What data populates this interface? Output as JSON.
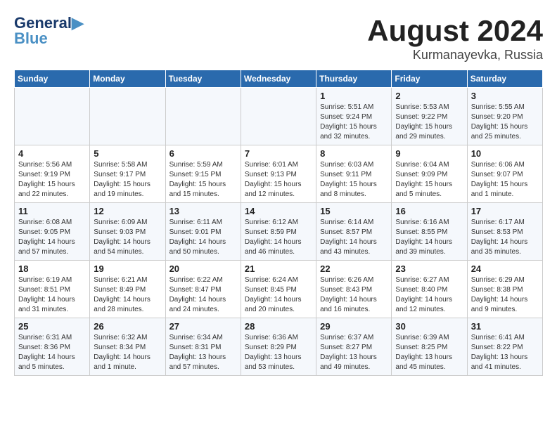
{
  "header": {
    "logo_general": "General",
    "logo_blue": "Blue",
    "month_year": "August 2024",
    "location": "Kurmanayevka, Russia"
  },
  "weekdays": [
    "Sunday",
    "Monday",
    "Tuesday",
    "Wednesday",
    "Thursday",
    "Friday",
    "Saturday"
  ],
  "weeks": [
    [
      {
        "day": "",
        "info": ""
      },
      {
        "day": "",
        "info": ""
      },
      {
        "day": "",
        "info": ""
      },
      {
        "day": "",
        "info": ""
      },
      {
        "day": "1",
        "info": "Sunrise: 5:51 AM\nSunset: 9:24 PM\nDaylight: 15 hours\nand 32 minutes."
      },
      {
        "day": "2",
        "info": "Sunrise: 5:53 AM\nSunset: 9:22 PM\nDaylight: 15 hours\nand 29 minutes."
      },
      {
        "day": "3",
        "info": "Sunrise: 5:55 AM\nSunset: 9:20 PM\nDaylight: 15 hours\nand 25 minutes."
      }
    ],
    [
      {
        "day": "4",
        "info": "Sunrise: 5:56 AM\nSunset: 9:19 PM\nDaylight: 15 hours\nand 22 minutes."
      },
      {
        "day": "5",
        "info": "Sunrise: 5:58 AM\nSunset: 9:17 PM\nDaylight: 15 hours\nand 19 minutes."
      },
      {
        "day": "6",
        "info": "Sunrise: 5:59 AM\nSunset: 9:15 PM\nDaylight: 15 hours\nand 15 minutes."
      },
      {
        "day": "7",
        "info": "Sunrise: 6:01 AM\nSunset: 9:13 PM\nDaylight: 15 hours\nand 12 minutes."
      },
      {
        "day": "8",
        "info": "Sunrise: 6:03 AM\nSunset: 9:11 PM\nDaylight: 15 hours\nand 8 minutes."
      },
      {
        "day": "9",
        "info": "Sunrise: 6:04 AM\nSunset: 9:09 PM\nDaylight: 15 hours\nand 5 minutes."
      },
      {
        "day": "10",
        "info": "Sunrise: 6:06 AM\nSunset: 9:07 PM\nDaylight: 15 hours\nand 1 minute."
      }
    ],
    [
      {
        "day": "11",
        "info": "Sunrise: 6:08 AM\nSunset: 9:05 PM\nDaylight: 14 hours\nand 57 minutes."
      },
      {
        "day": "12",
        "info": "Sunrise: 6:09 AM\nSunset: 9:03 PM\nDaylight: 14 hours\nand 54 minutes."
      },
      {
        "day": "13",
        "info": "Sunrise: 6:11 AM\nSunset: 9:01 PM\nDaylight: 14 hours\nand 50 minutes."
      },
      {
        "day": "14",
        "info": "Sunrise: 6:12 AM\nSunset: 8:59 PM\nDaylight: 14 hours\nand 46 minutes."
      },
      {
        "day": "15",
        "info": "Sunrise: 6:14 AM\nSunset: 8:57 PM\nDaylight: 14 hours\nand 43 minutes."
      },
      {
        "day": "16",
        "info": "Sunrise: 6:16 AM\nSunset: 8:55 PM\nDaylight: 14 hours\nand 39 minutes."
      },
      {
        "day": "17",
        "info": "Sunrise: 6:17 AM\nSunset: 8:53 PM\nDaylight: 14 hours\nand 35 minutes."
      }
    ],
    [
      {
        "day": "18",
        "info": "Sunrise: 6:19 AM\nSunset: 8:51 PM\nDaylight: 14 hours\nand 31 minutes."
      },
      {
        "day": "19",
        "info": "Sunrise: 6:21 AM\nSunset: 8:49 PM\nDaylight: 14 hours\nand 28 minutes."
      },
      {
        "day": "20",
        "info": "Sunrise: 6:22 AM\nSunset: 8:47 PM\nDaylight: 14 hours\nand 24 minutes."
      },
      {
        "day": "21",
        "info": "Sunrise: 6:24 AM\nSunset: 8:45 PM\nDaylight: 14 hours\nand 20 minutes."
      },
      {
        "day": "22",
        "info": "Sunrise: 6:26 AM\nSunset: 8:43 PM\nDaylight: 14 hours\nand 16 minutes."
      },
      {
        "day": "23",
        "info": "Sunrise: 6:27 AM\nSunset: 8:40 PM\nDaylight: 14 hours\nand 12 minutes."
      },
      {
        "day": "24",
        "info": "Sunrise: 6:29 AM\nSunset: 8:38 PM\nDaylight: 14 hours\nand 9 minutes."
      }
    ],
    [
      {
        "day": "25",
        "info": "Sunrise: 6:31 AM\nSunset: 8:36 PM\nDaylight: 14 hours\nand 5 minutes."
      },
      {
        "day": "26",
        "info": "Sunrise: 6:32 AM\nSunset: 8:34 PM\nDaylight: 14 hours\nand 1 minute."
      },
      {
        "day": "27",
        "info": "Sunrise: 6:34 AM\nSunset: 8:31 PM\nDaylight: 13 hours\nand 57 minutes."
      },
      {
        "day": "28",
        "info": "Sunrise: 6:36 AM\nSunset: 8:29 PM\nDaylight: 13 hours\nand 53 minutes."
      },
      {
        "day": "29",
        "info": "Sunrise: 6:37 AM\nSunset: 8:27 PM\nDaylight: 13 hours\nand 49 minutes."
      },
      {
        "day": "30",
        "info": "Sunrise: 6:39 AM\nSunset: 8:25 PM\nDaylight: 13 hours\nand 45 minutes."
      },
      {
        "day": "31",
        "info": "Sunrise: 6:41 AM\nSunset: 8:22 PM\nDaylight: 13 hours\nand 41 minutes."
      }
    ]
  ]
}
